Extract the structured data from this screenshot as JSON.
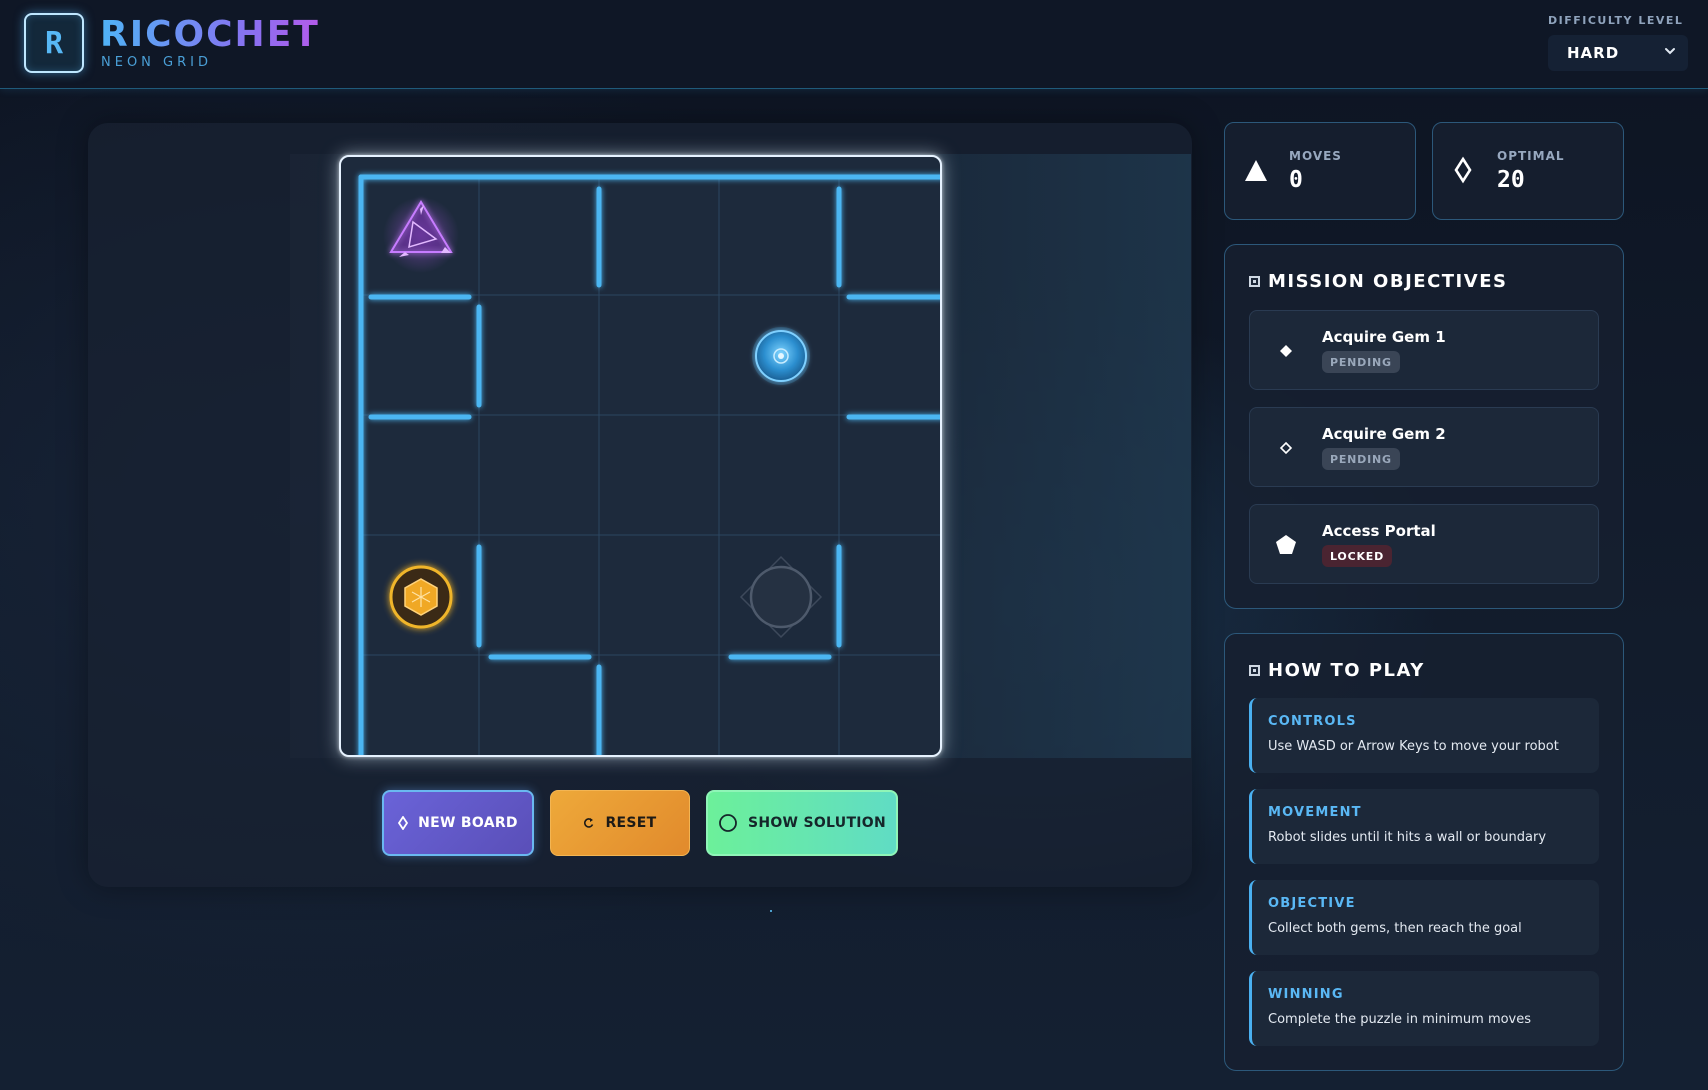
{
  "header": {
    "logo_letter": "R",
    "title": "RICOCHET",
    "subtitle": "NEON GRID",
    "difficulty_label": "DIFFICULTY LEVEL",
    "difficulty_value": "HARD",
    "difficulty_icon": "chevron-down-icon"
  },
  "board": {
    "rows": 5,
    "cols": 5,
    "pieces": [
      {
        "name": "robot-triangle",
        "icon": "triangle-robot-icon",
        "color": "#b65cf0",
        "row": 0,
        "col": 0
      },
      {
        "name": "gem-1",
        "icon": "blue-orb-icon",
        "color": "#4fb8f5",
        "row": 1,
        "col": 3
      },
      {
        "name": "gem-2",
        "icon": "hexagon-gem-icon",
        "color": "#f0a825",
        "row": 3,
        "col": 0
      },
      {
        "name": "portal",
        "icon": "portal-icon",
        "color": "#6a7688",
        "row": 3,
        "col": 3
      }
    ],
    "wall_color": "#4cb6f2"
  },
  "buttons": {
    "new_board": "NEW BOARD",
    "reset": "RESET",
    "show_solution": "SHOW SOLUTION"
  },
  "stats": {
    "moves_label": "MOVES",
    "moves_value": "0",
    "optimal_label": "OPTIMAL",
    "optimal_value": "20"
  },
  "objectives": {
    "title": "MISSION OBJECTIVES",
    "items": [
      {
        "label": "Acquire Gem 1",
        "status": "PENDING",
        "icon": "diamond-filled-icon"
      },
      {
        "label": "Acquire Gem 2",
        "status": "PENDING",
        "icon": "diamond-outline-icon"
      },
      {
        "label": "Access Portal",
        "status": "LOCKED",
        "icon": "pentagon-icon"
      }
    ]
  },
  "how_to_play": {
    "title": "HOW TO PLAY",
    "tips": [
      {
        "title": "CONTROLS",
        "text": "Use WASD or Arrow Keys to move your robot"
      },
      {
        "title": "MOVEMENT",
        "text": "Robot slides until it hits a wall or boundary"
      },
      {
        "title": "OBJECTIVE",
        "text": "Collect both gems, then reach the goal"
      },
      {
        "title": "WINNING",
        "text": "Complete the puzzle in minimum moves"
      }
    ]
  },
  "colors": {
    "accent": "#4fb3f6",
    "purple": "#b45bea",
    "background": "#0d1422"
  }
}
